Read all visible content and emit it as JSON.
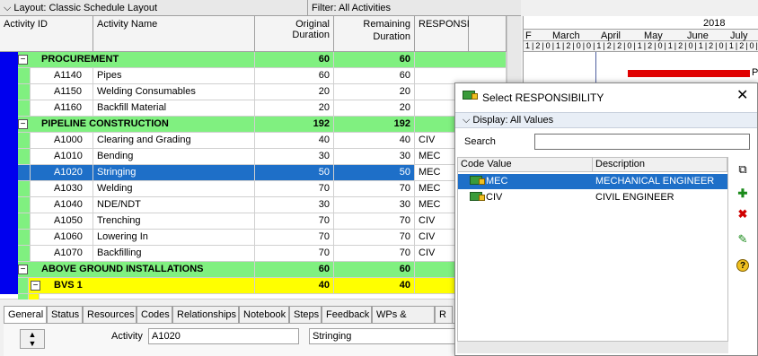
{
  "header": {
    "layout_label": "Layout: Classic Schedule Layout",
    "filter_label": "Filter: All Activities"
  },
  "columns": {
    "activity_id": "Activity ID",
    "activity_name": "Activity Name",
    "original_duration": "Original Duration",
    "remaining_duration_line1": "Remaining",
    "remaining_duration_line2": "Duration",
    "responsibility": "RESPONSIB"
  },
  "rows": [
    {
      "type": "wbs",
      "name": "PROCUREMENT",
      "od": "60",
      "rd": "60",
      "resp": ""
    },
    {
      "type": "act",
      "id": "A1140",
      "name": "Pipes",
      "od": "60",
      "rd": "60",
      "resp": ""
    },
    {
      "type": "act",
      "id": "A1150",
      "name": "Welding Consumables",
      "od": "20",
      "rd": "20",
      "resp": ""
    },
    {
      "type": "act",
      "id": "A1160",
      "name": "Backfill Material",
      "od": "20",
      "rd": "20",
      "resp": ""
    },
    {
      "type": "wbs",
      "name": "PIPELINE CONSTRUCTION",
      "od": "192",
      "rd": "192",
      "resp": ""
    },
    {
      "type": "act",
      "id": "A1000",
      "name": "Clearing and Grading",
      "od": "40",
      "rd": "40",
      "resp": "CIV"
    },
    {
      "type": "act",
      "id": "A1010",
      "name": "Bending",
      "od": "30",
      "rd": "30",
      "resp": "MEC"
    },
    {
      "type": "sel",
      "id": "A1020",
      "name": "Stringing",
      "od": "50",
      "rd": "50",
      "resp": "MEC"
    },
    {
      "type": "act",
      "id": "A1030",
      "name": "Welding",
      "od": "70",
      "rd": "70",
      "resp": "MEC"
    },
    {
      "type": "act",
      "id": "A1040",
      "name": "NDE/NDT",
      "od": "30",
      "rd": "30",
      "resp": "MEC"
    },
    {
      "type": "act",
      "id": "A1050",
      "name": "Trenching",
      "od": "70",
      "rd": "70",
      "resp": "CIV"
    },
    {
      "type": "act",
      "id": "A1060",
      "name": "Lowering In",
      "od": "70",
      "rd": "70",
      "resp": "CIV"
    },
    {
      "type": "act",
      "id": "A1070",
      "name": "Backfilling",
      "od": "70",
      "rd": "70",
      "resp": "CIV"
    },
    {
      "type": "wbs",
      "name": "ABOVE GROUND INSTALLATIONS",
      "od": "60",
      "rd": "60",
      "resp": ""
    },
    {
      "type": "wbs2",
      "name": "BVS 1",
      "od": "40",
      "rd": "40",
      "resp": ""
    }
  ],
  "gantt": {
    "year": "2018",
    "months": [
      "F",
      "March",
      "April",
      "May",
      "June",
      "July"
    ],
    "week_digits": "1|2|0|1|2|0|0|1|2|2|0|1|2|0|1|2|0|1|2|0|1|2|0|1|2",
    "bar_label": "Pi",
    "bar_color": "#e00000"
  },
  "bottom_tabs": [
    "General",
    "Status",
    "Resources",
    "Codes",
    "Relationships",
    "Notebook",
    "Steps",
    "Feedback",
    "WPs & Docs",
    "R"
  ],
  "detail": {
    "activity_label": "Activity",
    "activity_id": "A1020",
    "activity_name": "Stringing"
  },
  "dialog": {
    "title": "Select RESPONSIBILITY",
    "display_label": "Display: All Values",
    "search_label": "Search",
    "search_value": "",
    "col_code": "Code Value",
    "col_desc": "Description",
    "items": [
      {
        "code": "MEC",
        "desc": "MECHANICAL ENGINEER",
        "selected": true
      },
      {
        "code": "CIV",
        "desc": "CIVIL ENGINEER",
        "selected": false
      }
    ]
  },
  "colors": {
    "wbs_green": "#80f080",
    "wbs_yellow": "#ffff00",
    "selection_blue": "#1e6fc8"
  }
}
